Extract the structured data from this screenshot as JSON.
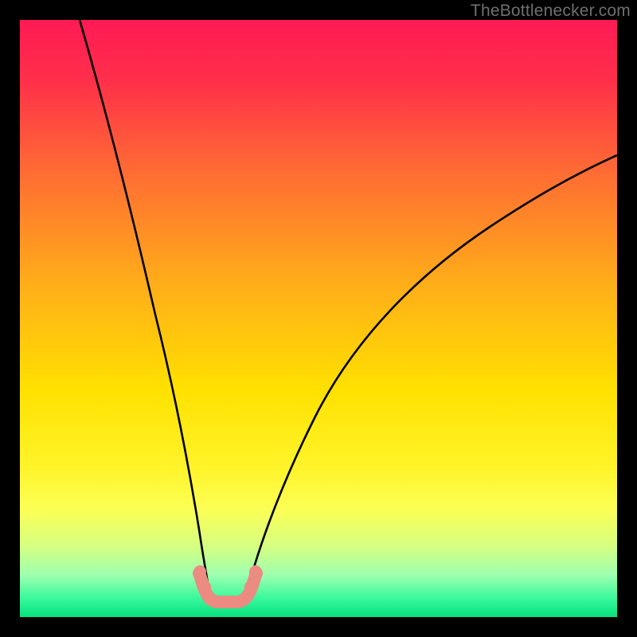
{
  "watermark": {
    "text": "TheBottlenecker.com"
  },
  "chart_data": {
    "type": "line",
    "title": "",
    "xlabel": "",
    "ylabel": "",
    "xlim": [
      0,
      100
    ],
    "ylim": [
      0,
      100
    ],
    "axes_visible": false,
    "frame": {
      "color": "#000000",
      "thickness_px": 25
    },
    "background_gradient": {
      "direction": "vertical",
      "stops": [
        {
          "pos": 0.0,
          "color": "#ff1a55"
        },
        {
          "pos": 0.1,
          "color": "#ff2f4a"
        },
        {
          "pos": 0.25,
          "color": "#ff6a34"
        },
        {
          "pos": 0.45,
          "color": "#ffb018"
        },
        {
          "pos": 0.62,
          "color": "#ffe100"
        },
        {
          "pos": 0.75,
          "color": "#fff42a"
        },
        {
          "pos": 0.82,
          "color": "#fbff55"
        },
        {
          "pos": 0.88,
          "color": "#d7ff80"
        },
        {
          "pos": 0.93,
          "color": "#9dffb0"
        },
        {
          "pos": 0.97,
          "color": "#35f89b"
        },
        {
          "pos": 1.0,
          "color": "#07e07e"
        }
      ]
    },
    "series": [
      {
        "name": "bottleneck-left",
        "stroke": "#000000",
        "x": [
          10.0,
          12.0,
          14.0,
          16.0,
          18.0,
          20.0,
          22.0,
          24.0,
          26.0,
          27.5,
          29.0,
          30.3,
          31.5
        ],
        "y": [
          100.0,
          91.0,
          82.0,
          73.0,
          63.5,
          54.0,
          44.5,
          35.0,
          25.5,
          18.5,
          12.0,
          7.0,
          3.5
        ]
      },
      {
        "name": "bottleneck-right",
        "stroke": "#000000",
        "x": [
          38.0,
          40.0,
          43.0,
          46.0,
          50.0,
          55.0,
          60.0,
          66.0,
          73.0,
          81.0,
          90.0,
          100.0
        ],
        "y": [
          3.5,
          8.0,
          14.0,
          20.0,
          27.0,
          34.5,
          41.0,
          47.5,
          53.5,
          59.5,
          65.0,
          70.5
        ]
      },
      {
        "name": "optimal-band-markers",
        "stroke": "#eb8b82",
        "type": "scatter",
        "x": [
          30.5,
          31.2,
          32.5,
          34.0,
          35.5,
          37.0,
          38.0,
          38.6
        ],
        "y": [
          6.5,
          4.0,
          2.7,
          2.5,
          2.5,
          2.8,
          4.2,
          6.8
        ]
      }
    ],
    "annotations": []
  }
}
